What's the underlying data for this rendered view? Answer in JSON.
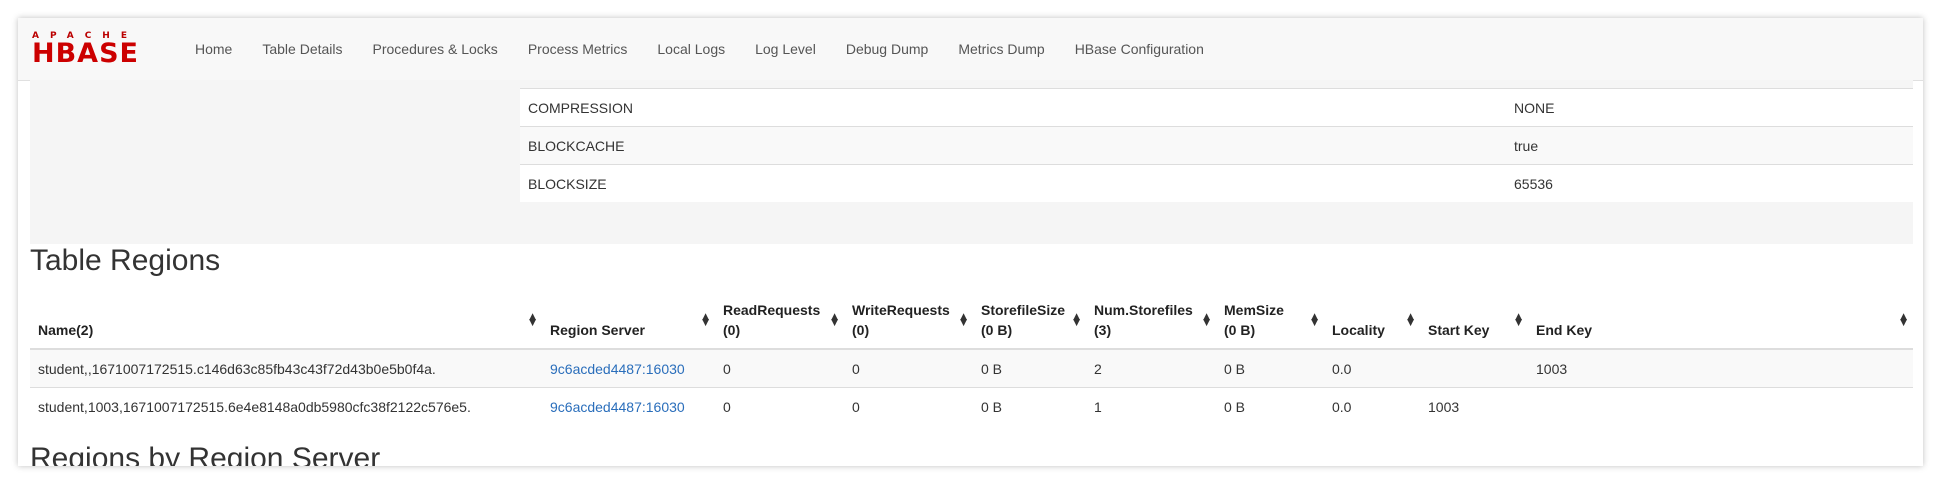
{
  "brand": {
    "top": "APACHE",
    "main": "HBASE"
  },
  "nav": [
    "Home",
    "Table Details",
    "Procedures & Locks",
    "Process Metrics",
    "Local Logs",
    "Log Level",
    "Debug Dump",
    "Metrics Dump",
    "HBase Configuration"
  ],
  "properties": [
    {
      "key": "COMPRESSION",
      "value": "NONE"
    },
    {
      "key": "BLOCKCACHE",
      "value": "true"
    },
    {
      "key": "BLOCKSIZE",
      "value": "65536"
    }
  ],
  "regions_title": "Table Regions",
  "regions_headers": [
    {
      "l1": "",
      "l2": "Name(2)"
    },
    {
      "l1": "",
      "l2": "Region Server"
    },
    {
      "l1": "ReadRequests",
      "l2": "(0)"
    },
    {
      "l1": "WriteRequests",
      "l2": "(0)"
    },
    {
      "l1": "StorefileSize",
      "l2": "(0 B)"
    },
    {
      "l1": "Num.Storefiles",
      "l2": "(3)"
    },
    {
      "l1": "MemSize",
      "l2": "(0 B)"
    },
    {
      "l1": "",
      "l2": "Locality"
    },
    {
      "l1": "",
      "l2": "Start Key"
    },
    {
      "l1": "",
      "l2": "End Key"
    }
  ],
  "regions_rows": [
    [
      "student,,1671007172515.c146d63c85fb43c43f72d43b0e5b0f4a.",
      "9c6acded4487:16030",
      "0",
      "0",
      "0 B",
      "2",
      "0 B",
      "0.0",
      "",
      "1003"
    ],
    [
      "student,1003,1671007172515.6e4e8148a0db5980cfc38f2122c576e5.",
      "9c6acded4487:16030",
      "0",
      "0",
      "0 B",
      "1",
      "0 B",
      "0.0",
      "1003",
      ""
    ]
  ],
  "next_title": "Regions by Region Server",
  "sort_icon": "sort-icon"
}
